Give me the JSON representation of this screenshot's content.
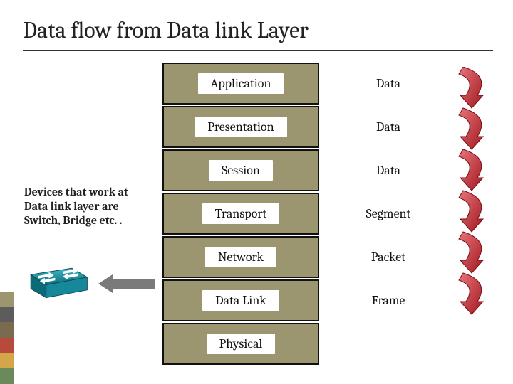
{
  "title": "Data flow from Data link Layer",
  "note_text": "Devices that work at Data link layer are Switch, Bridge etc. .",
  "layers": [
    {
      "name": "Application",
      "pdu": "Data"
    },
    {
      "name": "Presentation",
      "pdu": "Data"
    },
    {
      "name": "Session",
      "pdu": "Data"
    },
    {
      "name": "Transport",
      "pdu": "Segment"
    },
    {
      "name": "Network",
      "pdu": "Packet"
    },
    {
      "name": "Data Link",
      "pdu": "Frame"
    },
    {
      "name": "Physical",
      "pdu": ""
    }
  ],
  "colors": {
    "layer_bg": "#9b9570",
    "accent_red": "#b22027",
    "arrow_gray": "#7a7a7a"
  },
  "color_tab": [
    "#9b9570",
    "#5c5c5c",
    "#7a6a4f",
    "#b74a3a",
    "#d4a64a",
    "#6a8a5c"
  ]
}
